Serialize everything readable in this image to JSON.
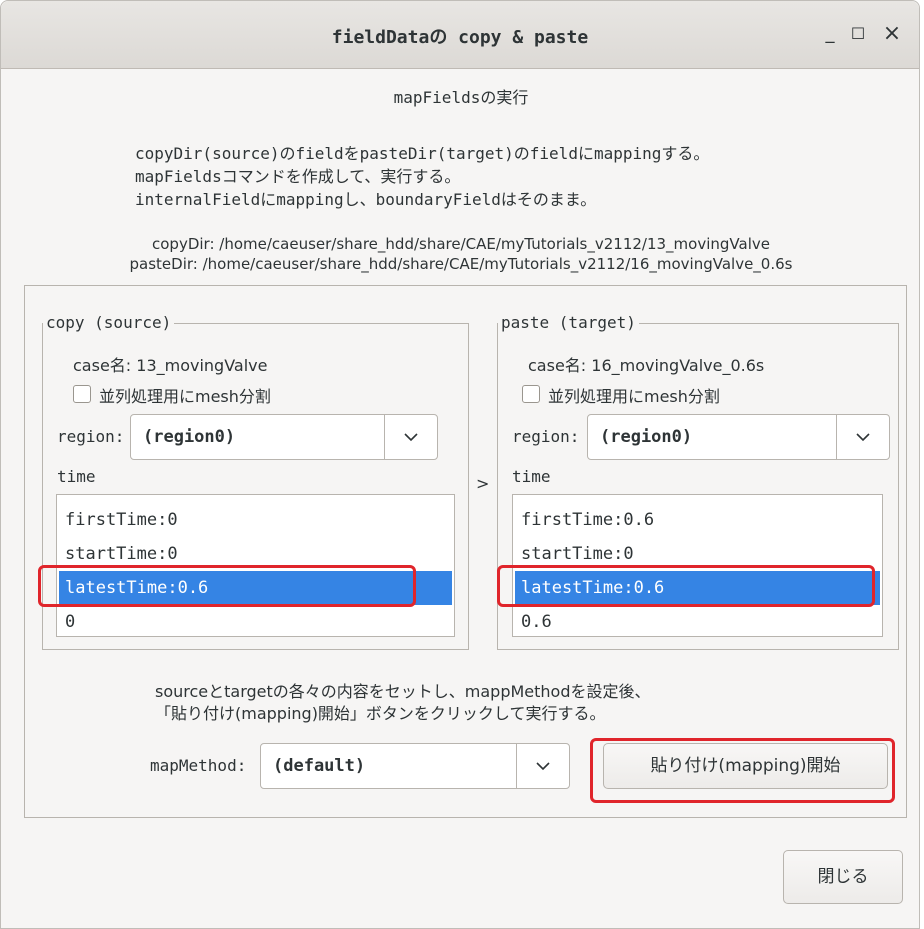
{
  "window": {
    "title": "fieldDataの copy & paste",
    "minimize_glyph": "_",
    "maximize_glyph": "☐",
    "close_glyph": "×"
  },
  "header": {
    "heading": "mapFieldsの実行",
    "desc1": "copyDir(source)のfieldをpasteDir(target)のfieldにmappingする。",
    "desc2": "mapFieldsコマンドを作成して、実行する。",
    "desc3": "internalFieldにmappingし、boundaryFieldはそのまま。",
    "copy_dir": "copyDir: /home/caeuser/share_hdd/share/CAE/myTutorials_v2112/13_movingValve",
    "paste_dir": "pasteDir: /home/caeuser/share_hdd/share/CAE/myTutorials_v2112/16_movingValve_0.6s"
  },
  "source": {
    "legend": "copy (source)",
    "case_name": "case名: 13_movingValve",
    "split_label": "並列処理用にmesh分割",
    "region_label": "region:",
    "region_value": "(region0)",
    "time_label": "time",
    "times": [
      "firstTime:0",
      "startTime:0",
      "latestTime:0.6",
      "0"
    ],
    "selected_index": 2
  },
  "target": {
    "legend": "paste (target)",
    "case_name": "case名: 16_movingValve_0.6s",
    "split_label": "並列処理用にmesh分割",
    "region_label": "region:",
    "region_value": "(region0)",
    "time_label": "time",
    "times": [
      "firstTime:0.6",
      "startTime:0",
      "latestTime:0.6",
      "0.6"
    ],
    "selected_index": 2
  },
  "arrow": ">",
  "instructions": {
    "line1": "sourceとtargetの各々の内容をセットし、mappMethodを設定後、",
    "line2": "「貼り付け(mapping)開始」ボタンをクリックして実行する。"
  },
  "map": {
    "label": "mapMethod:",
    "value": "(default)",
    "start_button": "貼り付け(mapping)開始"
  },
  "close_button": "閉じる",
  "colors": {
    "selection": "#3584e4",
    "highlight": "#e0252b"
  }
}
